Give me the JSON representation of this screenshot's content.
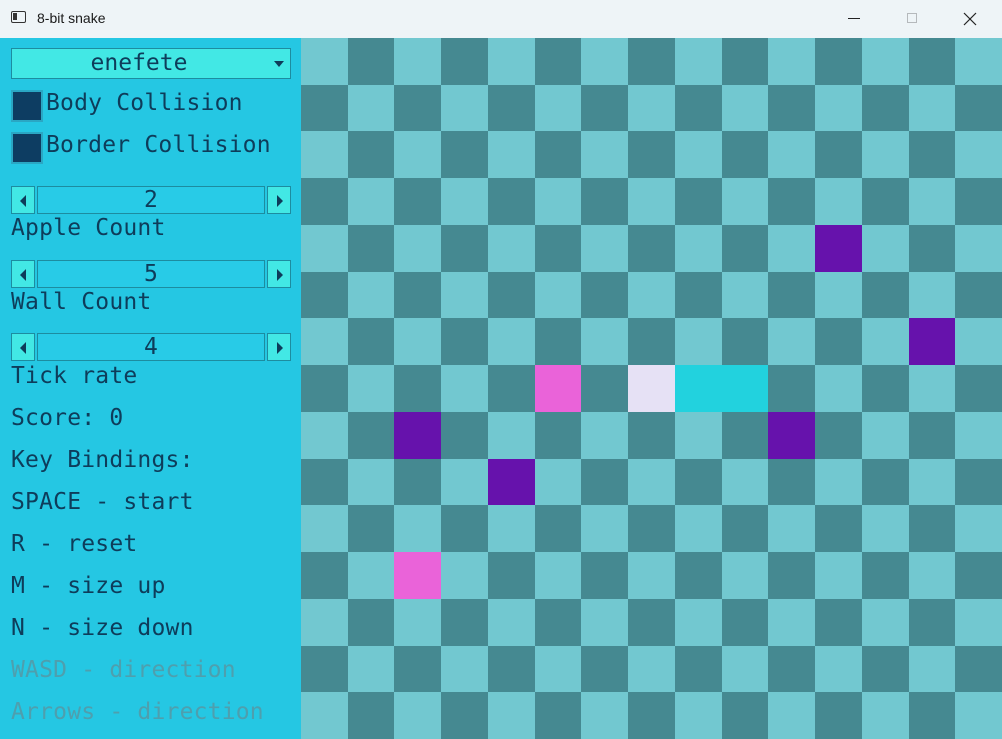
{
  "window": {
    "title": "8-bit snake",
    "minimize_icon": "minimize-icon",
    "maximize_icon": "maximize-icon",
    "close_icon": "close-icon"
  },
  "sidebar": {
    "theme_select": {
      "value": "enefete"
    },
    "body_collision": {
      "label": "Body Collision",
      "checked": true
    },
    "border_collision": {
      "label": "Border Collision",
      "checked": true
    },
    "apple_count": {
      "value": "2",
      "label": "Apple Count"
    },
    "wall_count": {
      "value": "5",
      "label": "Wall Count"
    },
    "tick_rate": {
      "value": "4",
      "label": "Tick rate"
    },
    "score": "Score: 0",
    "key_bindings": {
      "title": "Key Bindings:",
      "items": [
        "SPACE - start",
        "R - reset",
        "M - size up",
        "N - size down",
        "WASD - direction",
        "Arrows - direction"
      ]
    }
  },
  "board": {
    "rows": 15,
    "cols": 15,
    "colors": {
      "light": "#72c8d0",
      "dark": "#458991",
      "wall": "#6612ac",
      "apple": "#ea63d9",
      "snake_head": "#e6e1f5",
      "snake_body": "#22d2de"
    },
    "walls": [
      [
        11,
        4
      ],
      [
        13,
        6
      ],
      [
        2,
        8
      ],
      [
        10,
        8
      ],
      [
        4,
        9
      ]
    ],
    "apples": [
      [
        5,
        7
      ],
      [
        2,
        11
      ]
    ],
    "snake": {
      "head": [
        7,
        7
      ],
      "body": [
        [
          8,
          7
        ],
        [
          9,
          7
        ]
      ]
    }
  }
}
